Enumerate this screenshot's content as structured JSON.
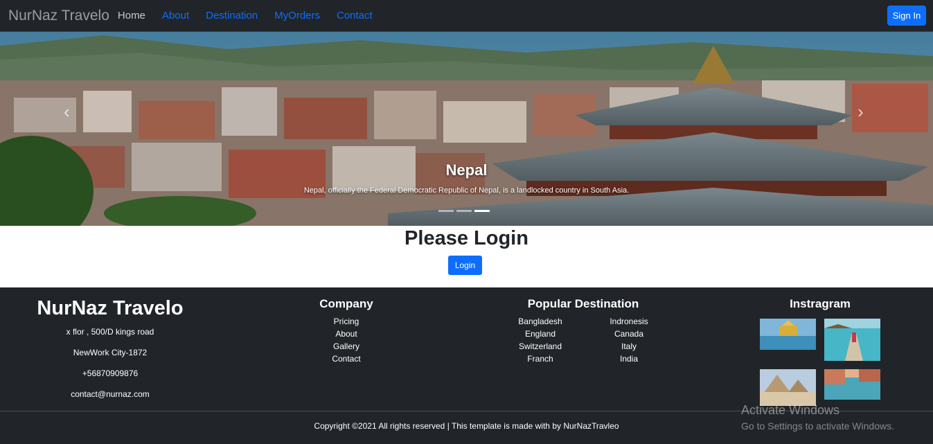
{
  "nav": {
    "brand": "NurNaz Travelo",
    "links": [
      "Home",
      "About",
      "Destination",
      "MyOrders",
      "Contact"
    ],
    "signin": "Sign In"
  },
  "hero": {
    "title": "Nepal",
    "text": "Nepal, officially the Federal Democratic Republic of Nepal, is a landlocked country in South Asia.",
    "prev_icon": "chevron-left-icon",
    "next_icon": "chevron-right-icon",
    "slides": 3,
    "active_slide": 3
  },
  "login": {
    "title": "Please Login",
    "button": "Login"
  },
  "footer": {
    "brand": "NurNaz Travelo",
    "address": "x flor , 500/D kings road",
    "city": "NewWork City-1872",
    "phone": "+56870909876",
    "email": "contact@nurnaz.com",
    "company_heading": "Company",
    "company_links": [
      "Pricing",
      "About",
      "Gallery",
      "Contact"
    ],
    "popular_heading": "Popular Destination",
    "popular_left": [
      "Bangladesh",
      "England",
      "Switzerland",
      "Franch"
    ],
    "popular_right": [
      "Indronesis",
      "Canada",
      "Italy",
      "India"
    ],
    "instagram_heading": "Instragram",
    "copyright": "Copyright ©2021 All rights reserved | This template is made with by NurNazTravleo"
  },
  "os_watermark": {
    "title": "Activate Windows",
    "subtitle": "Go to Settings to activate Windows."
  },
  "colors": {
    "navbar_bg": "#212529",
    "primary": "#0d6efd",
    "footer_bg": "#212529"
  }
}
